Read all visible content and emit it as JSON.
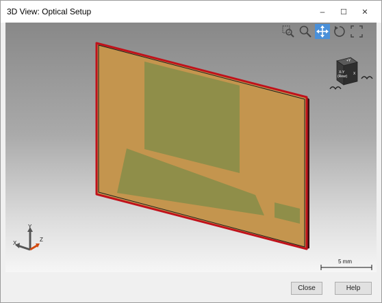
{
  "window": {
    "title": "3D View: Optical Setup",
    "controls": {
      "minimize": "–",
      "maximize": "☐",
      "close": "✕"
    }
  },
  "viewport": {
    "toolbar": [
      {
        "name": "zoom-window-icon",
        "active": false
      },
      {
        "name": "zoom-icon",
        "active": false
      },
      {
        "name": "pan-icon",
        "active": true
      },
      {
        "name": "rotate-icon",
        "active": false
      },
      {
        "name": "fit-all-icon",
        "active": false
      }
    ],
    "view_cube": {
      "front_label_line1": "X-Y",
      "front_label_line2": "(Rear)",
      "top_label": "+Y",
      "side_label": "X"
    },
    "axes": {
      "x": "X",
      "y": "Y",
      "z": "Z"
    },
    "scale_bar_label": "5 mm"
  },
  "footer": {
    "close_label": "Close",
    "help_label": "Help"
  },
  "colors": {
    "plate_fill": "#c4954e",
    "plate_border": "#c0121b",
    "region_fill": "#8f8e49",
    "pan_active": "#4a90d9"
  }
}
